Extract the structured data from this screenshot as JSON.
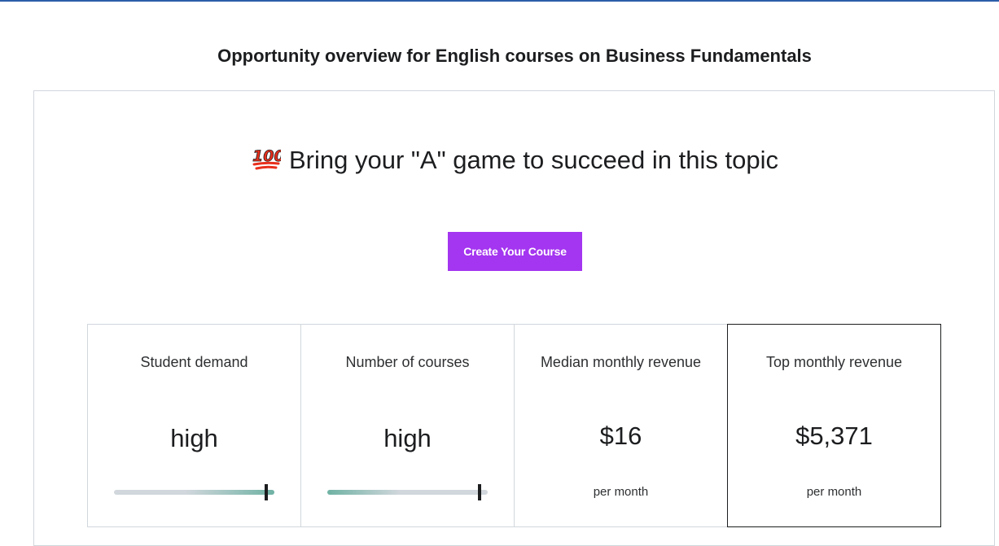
{
  "page": {
    "overview_prefix": "Opportunity overview for English courses on",
    "topic": "Business Fundamentals",
    "accent_color": "#a435f0"
  },
  "card": {
    "headline_icon": "hundred-points-icon",
    "headline": "Bring your \"A\" game to succeed in this topic",
    "cta_label": "Create Your Course"
  },
  "metrics": [
    {
      "label": "Student demand",
      "value": "high",
      "level": 0.95
    },
    {
      "label": "Number of courses",
      "value": "high",
      "level": 0.95
    },
    {
      "label": "Median monthly revenue",
      "value": "$16",
      "unit": "per month"
    },
    {
      "label": "Top monthly revenue",
      "value": "$5,371",
      "unit": "per month",
      "selected": true
    }
  ]
}
